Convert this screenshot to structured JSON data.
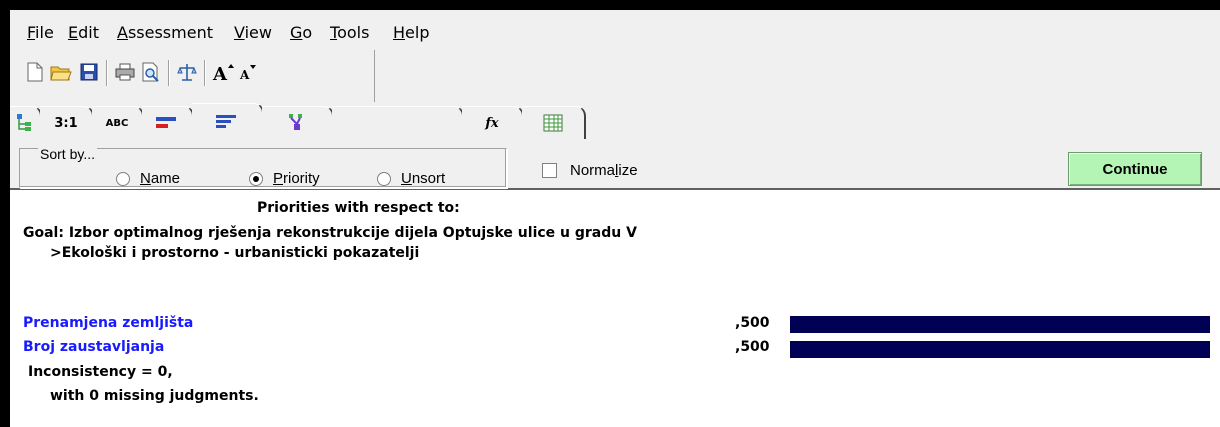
{
  "menu": {
    "items": [
      {
        "accel": "F",
        "rest": "ile"
      },
      {
        "accel": "E",
        "rest": "dit"
      },
      {
        "accel": "A",
        "rest": "ssessment"
      },
      {
        "accel": "V",
        "rest": "iew"
      },
      {
        "accel": "G",
        "rest": "o"
      },
      {
        "accel": "T",
        "rest": "ools"
      },
      {
        "accel": "H",
        "rest": "elp"
      }
    ]
  },
  "toolbar": {
    "icons": [
      "new-file-icon",
      "open-folder-icon",
      "save-icon",
      "print-icon",
      "print-preview-icon",
      "balance-icon",
      "font-larger-icon",
      "font-smaller-icon"
    ]
  },
  "tabs": {
    "labels": [
      "",
      "3:1",
      "ABC",
      "",
      "",
      "",
      "fx",
      ""
    ],
    "icons": [
      "tree-icon",
      "",
      "",
      "bar-chart-red-icon",
      "bar-chart-blue-icon",
      "hierarchy-icon",
      "formula-icon",
      "grid-icon"
    ]
  },
  "sort": {
    "legend": "Sort by...",
    "options": [
      {
        "accel": "N",
        "rest": "ame",
        "checked": false
      },
      {
        "accel": "P",
        "rest": "riority",
        "checked": true
      },
      {
        "accel": "U",
        "rest": "nsort",
        "checked": false
      }
    ],
    "normalize_pre": "Norma",
    "normalize_accel": "l",
    "normalize_post": "ize",
    "normalize_checked": false,
    "continue_label": "Continue"
  },
  "content": {
    "heading": "Priorities with respect to:",
    "goal": "Goal: Izbor optimalnog rješenja rekonstrukcije dijela Optujske ulice u gradu V",
    "criterion": ">Ekološki i prostorno - urbanisticki pokazatelji",
    "bar_color": "#000055",
    "items": [
      {
        "name": "Prenamjena zemljišta",
        "value_text": ",500",
        "value": 0.5
      },
      {
        "name": "Broj zaustavljanja",
        "value_text": ",500",
        "value": 0.5
      }
    ],
    "inconsistency": "Inconsistency = 0,",
    "missing": "with 0  missing judgments."
  }
}
